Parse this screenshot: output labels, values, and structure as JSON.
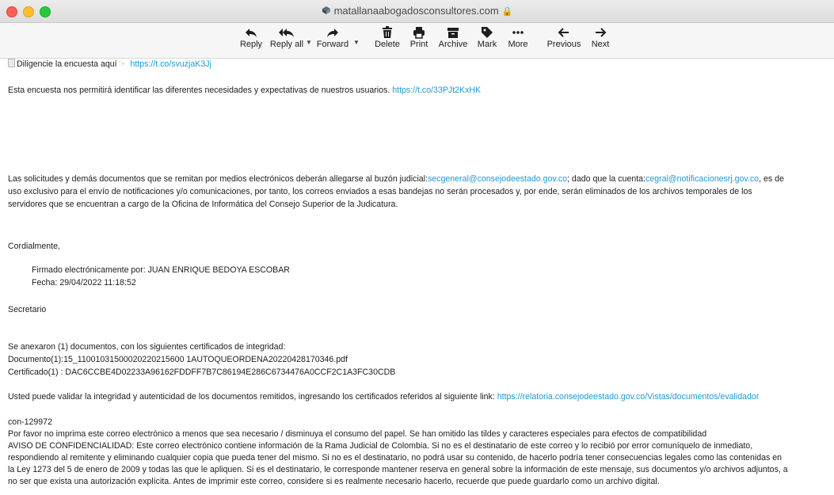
{
  "window": {
    "title": "matallanaabogadosconsultores.com"
  },
  "toolbar": {
    "reply": "Reply",
    "reply_all": "Reply all",
    "forward": "Forward",
    "delete": "Delete",
    "print": "Print",
    "archive": "Archive",
    "mark": "Mark",
    "more": "More",
    "previous": "Previous",
    "next": "Next"
  },
  "email": {
    "survey_text": "Diligencie la encuesta aquí",
    "survey_link": "https://t.co/svuzjaK3Jj",
    "survey_para": "Esta encuesta nos permitirá identificar las diferentes necesidades y expectativas de nuestros usuarios.",
    "survey_para_link": "https://t.co/33PJt2KxHK",
    "notice_1a": "Las solicitudes y demás documentos que se remitan por medios electrónicos deberán allegarse al buzón judicial:",
    "notice_1_link_a": "secgeneral@consejodeestado.gov.co",
    "notice_1b": "; dado que la cuenta:",
    "notice_1_link_b": "cegral@notificacionesrj.gov.co",
    "notice_1c": ", es de",
    "notice_2": "uso exclusivo para el envío de notificaciones y/o comunicaciones, por tanto, los correos enviados a esas bandejas no serán procesados y, por ende, serán eliminados de los archivos temporales de los",
    "notice_3": "servidores que se encuentran a cargo de la Oficina de Informática del Consejo Superior de la Judicatura.",
    "closing": "Cordialmente,",
    "signed_by": "Firmado electrónicamente por:  JUAN ENRIQUE BEDOYA ESCOBAR",
    "date": "Fecha:  29/04/2022 11:18:52",
    "role": "Secretario",
    "attach_intro": "Se anexaron (1) documentos, con los siguientes certificados de integridad:",
    "attach_doc": "Documento(1):15_11001031500020220215600 1AUTOQUEORDENA20220428170346.pdf",
    "attach_cert": "Certificado(1) : DAC6CCBE4D02233A96162FDDFF7B7C86194E286C6734476A0CCF2C1A3FC30CDB",
    "validate_text": "Usted puede validar la integridad y autenticidad de los documentos remitidos, ingresando los certificados referidos al siguiente link:",
    "validate_link": "https://relatoria.consejodeestado.gov.co/Vistas/documentos/evalidador",
    "ref": "con-129972",
    "footer_1": "Por favor no imprima este correo electrónico a menos que sea necesario / disminuya el consumo del papel. Se han omitido las tildes y caracteres especiales para efectos de compatibilidad",
    "footer_2": "AVISO DE CONFIDENCIALIDAD: Este correo electrónico contiene información de la Rama Judicial de Colombia. Si no es el destinatario de este correo y lo recibió por error comuníquelo de inmediato,",
    "footer_3": "respondiendo al remitente y eliminando cualquier copia que pueda tener del mismo. Si no es el destinatario, no podrá usar su contenido, de hacerlo podría tener consecuencias legales como las contenidas en",
    "footer_4": "la Ley 1273 del 5 de enero de 2009 y todas las que le apliquen. Si es el destinatario, le corresponde mantener reserva en general sobre la información de este mensaje, sus documentos y/o archivos adjuntos, a",
    "footer_5": "no ser que exista una autorización explícita. Antes de imprimir este correo, considere si es realmente necesario hacerlo, recuerde que puede guardarlo como un archivo digital."
  }
}
